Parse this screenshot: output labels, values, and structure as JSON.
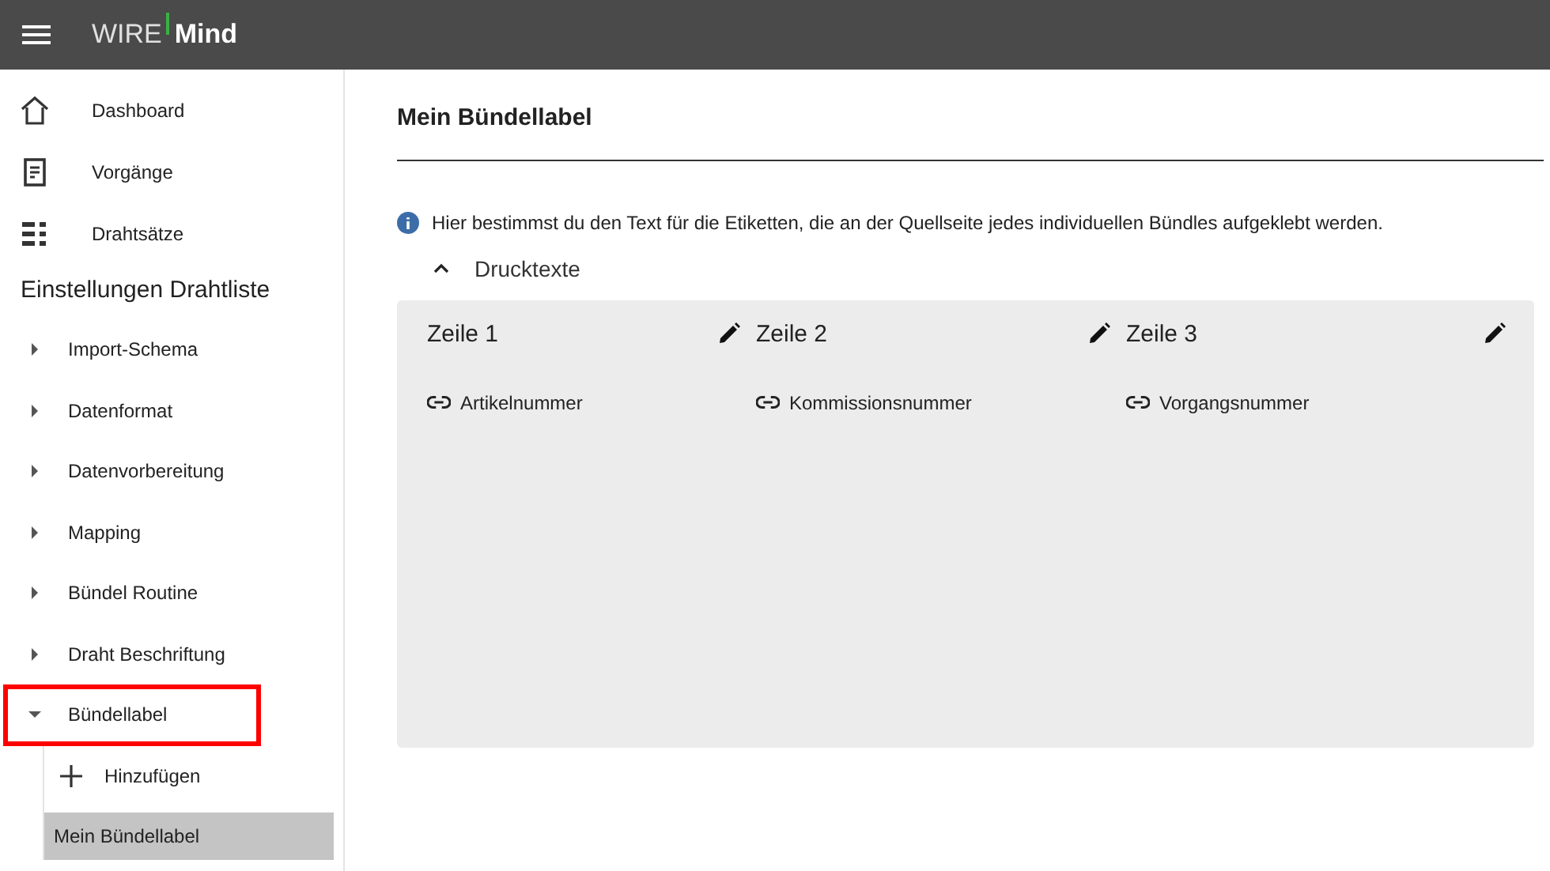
{
  "app_bar": {
    "logo_left": "WIRE",
    "logo_right": "Mind"
  },
  "sidebar": {
    "nav": [
      {
        "label": "Dashboard",
        "kind": "home"
      },
      {
        "label": "Vorgänge",
        "kind": "document"
      },
      {
        "label": "Drahtsätze",
        "kind": "list"
      }
    ],
    "section_title": "Einstellungen Drahtliste",
    "items": [
      {
        "label": "Import-Schema",
        "expanded": false,
        "highlighted": false
      },
      {
        "label": "Datenformat",
        "expanded": false,
        "highlighted": false
      },
      {
        "label": "Datenvorbereitung",
        "expanded": false,
        "highlighted": false
      },
      {
        "label": "Mapping",
        "expanded": false,
        "highlighted": false
      },
      {
        "label": "Bündel Routine",
        "expanded": false,
        "highlighted": false
      },
      {
        "label": "Draht Beschriftung",
        "expanded": false,
        "highlighted": false
      },
      {
        "label": "Bündellabel",
        "expanded": true,
        "highlighted": true,
        "children": [
          {
            "kind": "add",
            "label": "Hinzufügen",
            "selected": false
          },
          {
            "kind": "entry",
            "label": "Mein Bündellabel",
            "selected": true
          }
        ]
      }
    ]
  },
  "main": {
    "title": "Mein Bündellabel",
    "info": "Hier bestimmst du den Text für die Etiketten, die an der Quellseite jedes individuellen Bündles aufgeklebt werden.",
    "section": {
      "label": "Drucktexte",
      "expanded": true
    },
    "lines": [
      {
        "title": "Zeile 1",
        "field": "Artikelnummer"
      },
      {
        "title": "Zeile 2",
        "field": "Kommissionsnummer"
      },
      {
        "title": "Zeile 3",
        "field": "Vorgangsnummer"
      }
    ]
  }
}
